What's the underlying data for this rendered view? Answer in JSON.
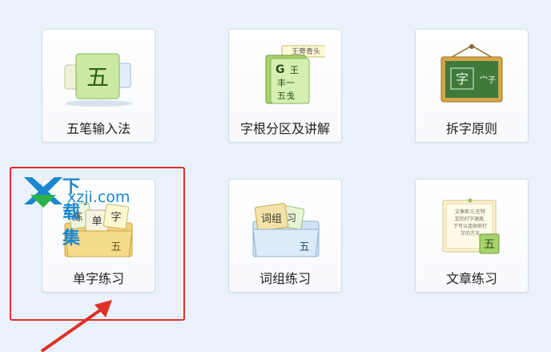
{
  "menu": {
    "items": [
      {
        "label": "五笔输入法"
      },
      {
        "label": "字根分区及讲解"
      },
      {
        "label": "拆字原则"
      },
      {
        "label": "单字练习"
      },
      {
        "label": "词组练习"
      },
      {
        "label": "文章练习"
      }
    ]
  },
  "icon_text": {
    "wubi_char": "五",
    "zigen_header": "王旁青头",
    "zigen_g": "G",
    "zigen_lines": [
      "王",
      "丰一",
      "五戋"
    ],
    "chaizi_left": "字",
    "chaizi_right": "宀子",
    "danzi_cards": [
      "练",
      "单",
      "字"
    ],
    "danzi_folder_char": "五",
    "cizu_card": "词组",
    "cizu_card2": "习",
    "cizu_folder_char": "五",
    "wenzhang_note": [
      "文章练习,在特",
      "定的打字速度,",
      "下可以连续练打",
      "字的方法"
    ],
    "wenzhang_char": "五"
  },
  "watermark": {
    "title": "下载集",
    "url": "xzji.com"
  },
  "colors": {
    "highlight": "#e0302a",
    "accent_green": "#6db33f",
    "watermark_blue": "#1a86d0"
  }
}
